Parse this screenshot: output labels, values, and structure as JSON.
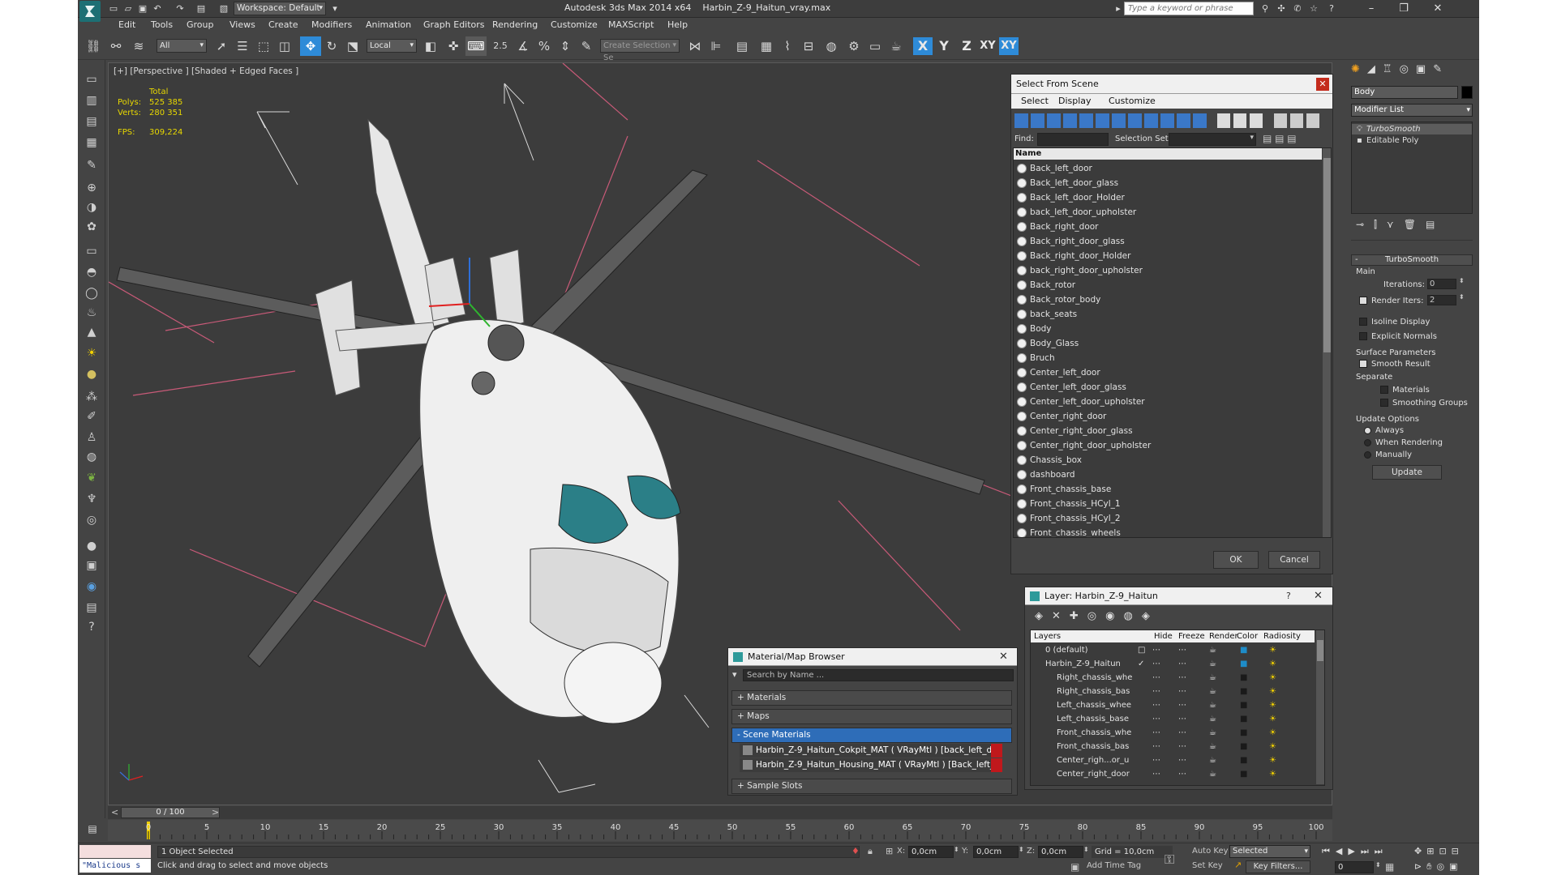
{
  "window": {
    "app_title": "Autodesk 3ds Max  2014 x64",
    "file_name": "Harbin_Z-9_Haitun_vray.max",
    "workspace": "Workspace: Default",
    "search_placeholder": "Type a keyword or phrase"
  },
  "menu": [
    "Edit",
    "Tools",
    "Group",
    "Views",
    "Create",
    "Modifiers",
    "Animation",
    "Graph Editors",
    "Rendering",
    "Customize",
    "MAXScript",
    "Help"
  ],
  "toolbar": {
    "filter": "All",
    "ref_coord": "Local",
    "selection_set": "Create Selection Se",
    "snap_label": "2.5",
    "axes": [
      "X",
      "Y",
      "Z",
      "XY",
      "XY"
    ]
  },
  "viewport": {
    "label": "[+] [Perspective ] [Shaded + Edged Faces ]",
    "stats": {
      "total_label": "Total",
      "polys_label": "Polys:",
      "polys": "525 385",
      "verts_label": "Verts:",
      "verts": "280 351",
      "fps_label": "FPS:",
      "fps": "309,224"
    }
  },
  "select_from_scene": {
    "title": "Select From Scene",
    "menu": [
      "Select",
      "Display",
      "Customize"
    ],
    "find_label": "Find:",
    "selection_set_label": "Selection Set:",
    "column_name": "Name",
    "items": [
      "Back_left_door",
      "Back_left_door_glass",
      "Back_left_door_Holder",
      "back_left_door_upholster",
      "Back_right_door",
      "Back_right_door_glass",
      "Back_right_door_Holder",
      "back_right_door_upholster",
      "Back_rotor",
      "Back_rotor_body",
      "back_seats",
      "Body",
      "Body_Glass",
      "Bruch",
      "Center_left_door",
      "Center_left_door_glass",
      "Center_left_door_upholster",
      "Center_right_door",
      "Center_right_door_glass",
      "Center_right_door_upholster",
      "Chassis_box",
      "dashboard",
      "Front_chassis_base",
      "Front_chassis_HCyl_1",
      "Front_chassis_HCyl_2",
      "Front_chassis_wheels"
    ],
    "ok": "OK",
    "cancel": "Cancel"
  },
  "layer_dialog": {
    "title": "Layer: Harbin_Z-9_Haitun",
    "help": "?",
    "columns": [
      "Layers",
      "Hide",
      "Freeze",
      "Render",
      "Color",
      "Radiosity"
    ],
    "rows": [
      "0 (default)",
      "Harbin_Z-9_Haitun",
      "Right_chassis_whe",
      "Right_chassis_bas",
      "Left_chassis_whee",
      "Left_chassis_base",
      "Front_chassis_whe",
      "Front_chassis_bas",
      "Center_righ...or_u",
      "Center_right_door"
    ]
  },
  "material_browser": {
    "title": "Material/Map Browser",
    "search_placeholder": "Search by Name ...",
    "groups": [
      "+ Materials",
      "+ Maps",
      "- Scene Materials",
      "+ Sample Slots"
    ],
    "materials": [
      "Harbin_Z-9_Haitun_Cokpit_MAT ( VRayMtl ) [back_left_door_u...",
      "Harbin_Z-9_Haitun_Housing_MAT ( VRayMtl ) [Back_left_door,..."
    ]
  },
  "command_panel": {
    "object_name": "Body",
    "modifier_list": "Modifier List",
    "stack": [
      "TurboSmooth",
      "Editable Poly"
    ],
    "rollout_title": "TurboSmooth",
    "main_label": "Main",
    "iterations_label": "Iterations:",
    "iterations": "0",
    "render_iters_label": "Render Iters:",
    "render_iters": "2",
    "isoline": "Isoline Display",
    "explicit_normals": "Explicit Normals",
    "surface_params": "Surface Parameters",
    "smooth_result": "Smooth Result",
    "separate": "Separate",
    "materials": "Materials",
    "smoothing_groups": "Smoothing Groups",
    "update_options": "Update Options",
    "always": "Always",
    "when_rendering": "When Rendering",
    "manually": "Manually",
    "update_btn": "Update"
  },
  "timeline": {
    "frame": "0 / 100",
    "ticks": [
      "0",
      "5",
      "10",
      "15",
      "20",
      "25",
      "30",
      "35",
      "40",
      "45",
      "50",
      "55",
      "60",
      "65",
      "70",
      "75",
      "80",
      "85",
      "90",
      "95",
      "100"
    ]
  },
  "status": {
    "selected": "1 Object Selected",
    "prompt": "Click and drag to select and move objects",
    "script": "\"Malicious s",
    "x_label": "X:",
    "x": "0,0cm",
    "y_label": "Y:",
    "y": "0,0cm",
    "z_label": "Z:",
    "z": "0,0cm",
    "grid": "Grid = 10,0cm",
    "add_time_tag": "Add Time Tag",
    "auto_key": "Auto Key",
    "set_key": "Set Key",
    "selected_mode": "Selected",
    "key_filters": "Key Filters...",
    "frame_field": "0"
  }
}
